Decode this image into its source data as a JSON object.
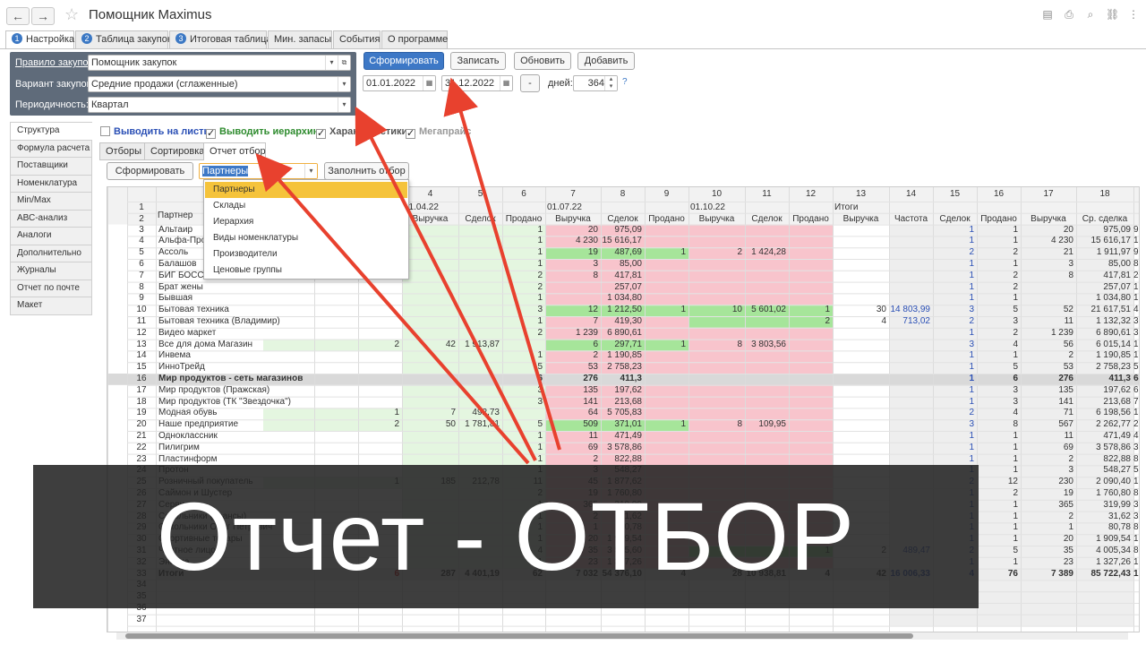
{
  "window": {
    "title": "Помощник Maximus"
  },
  "tabs": [
    {
      "num": "1",
      "label": "Настройка"
    },
    {
      "num": "2",
      "label": "Таблица закупок"
    },
    {
      "num": "3",
      "label": "Итоговая таблица"
    },
    {
      "num": "",
      "label": "Мин. запасы"
    },
    {
      "num": "",
      "label": "События"
    },
    {
      "num": "",
      "label": "О программе"
    }
  ],
  "params": {
    "rule_label": "Правило закупок:",
    "rule_value": "Помощник закупок",
    "variant_label": "Вариант закупок:",
    "variant_value": "Средние продажи (сглаженные)",
    "period_label": "Периодичность:",
    "period_value": "Квартал"
  },
  "toolbar": {
    "form": "Сформировать",
    "write": "Записать",
    "refresh": "Обновить",
    "add": "Добавить",
    "date_from": "01.01.2022",
    "date_to": "31.12.2022",
    "minus": "-",
    "days_label": "дней:",
    "days": "364",
    "help": "?"
  },
  "sidebar": [
    "Структура",
    "Формула расчета",
    "Поставщики",
    "Номенклатура",
    "Min/Max",
    "АВС-анализ",
    "Аналоги",
    "Дополнительно",
    "Журналы",
    "Отчет по почте",
    "Макет"
  ],
  "checkboxes": [
    {
      "label": "Выводить на листы",
      "checked": "",
      "color": "#2a4fb5"
    },
    {
      "label": "Выводить иерархию",
      "checked": "✓",
      "color": "#2e8b2e"
    },
    {
      "label": "Характеристики",
      "checked": "✓",
      "color": "#555"
    },
    {
      "label": "Мегапрайс",
      "checked": "✓",
      "color": "#999"
    }
  ],
  "subtabs": [
    "Отборы",
    "Сортировка",
    "Отчет отбор"
  ],
  "report": {
    "form": "Сформировать",
    "select_value": "Партнеры",
    "fill": "Заполнить отбор"
  },
  "dropdown": [
    "Партнеры",
    "Склады",
    "Иерархия",
    "Виды номенклатуры",
    "Производители",
    "Ценовые группы"
  ],
  "grid": {
    "colnums": [
      "4",
      "5",
      "6",
      "7",
      "8",
      "9",
      "10",
      "11",
      "12",
      "13",
      "14",
      "15",
      "16",
      "17",
      "18"
    ],
    "periods": [
      "01.04.22",
      "01.07.22",
      "01.10.22",
      "Итоги"
    ],
    "partner_hdr": "Партнер",
    "subhdr": [
      "Выручка",
      "Сделок",
      "Продано",
      "Выручка",
      "Сделок",
      "Продано",
      "Выручка",
      "Сделок",
      "Продано",
      "Выручка",
      "Частота",
      "Сделок",
      "Продано",
      "Выручка",
      "Ср. сделка"
    ],
    "rows": [
      [
        "3",
        "Альтаир",
        "",
        "",
        "",
        "1",
        "20",
        "975,09",
        "",
        "",
        "",
        "",
        "",
        "",
        "1",
        "1",
        "20",
        "975,09",
        "975,09"
      ],
      [
        "4",
        "Альфа-Про",
        "",
        "",
        "",
        "1",
        "4 230",
        "15 616,17",
        "",
        "",
        "",
        "",
        "",
        "",
        "1",
        "1",
        "4 230",
        "15 616,17",
        "15 616,17"
      ],
      [
        "5",
        "Ассоль",
        "",
        "",
        "",
        "1",
        "19",
        "487,69",
        "1",
        "2",
        "1 424,28",
        "",
        "",
        "",
        "2",
        "2",
        "21",
        "1 911,97",
        "955,99"
      ],
      [
        "6",
        "Балашов",
        "",
        "",
        "",
        "1",
        "3",
        "85,00",
        "",
        "",
        "",
        "",
        "",
        "",
        "1",
        "1",
        "3",
        "85,00",
        "85,00"
      ],
      [
        "7",
        "БИГ БОСС",
        "",
        "",
        "",
        "2",
        "8",
        "417,81",
        "",
        "",
        "",
        "",
        "",
        "",
        "1",
        "2",
        "8",
        "417,81",
        "208,91"
      ],
      [
        "8",
        "Брат жены",
        "",
        "",
        "",
        "2",
        "",
        "257,07",
        "",
        "",
        "",
        "",
        "",
        "",
        "1",
        "2",
        "",
        "257,07",
        "128,54"
      ],
      [
        "9",
        "Бывшая",
        "",
        "",
        "",
        "1",
        "",
        "1 034,80",
        "",
        "",
        "",
        "",
        "",
        "",
        "1",
        "1",
        "",
        "1 034,80",
        "1 034,80"
      ],
      [
        "10",
        "Бытовая техника",
        "",
        "",
        "",
        "3",
        "12",
        "1 212,50",
        "1",
        "10",
        "5 601,02",
        "1",
        "30",
        "14 803,99",
        "3",
        "5",
        "52",
        "21 617,51",
        "4 323,50"
      ],
      [
        "11",
        "Бытовая техника (Владимир)",
        "",
        "",
        "",
        "1",
        "7",
        "419,30",
        "",
        "",
        "",
        "2",
        "4",
        "713,02",
        "2",
        "3",
        "11",
        "1 132,32",
        "377,44"
      ],
      [
        "12",
        "Видео маркет",
        "",
        "",
        "",
        "2",
        "1 239",
        "6 890,61",
        "",
        "",
        "",
        "",
        "",
        "",
        "1",
        "2",
        "1 239",
        "6 890,61",
        "3 445,31"
      ],
      [
        "13",
        "Все для дома Магазин",
        "2",
        "42",
        "1 913,87",
        "",
        "6",
        "297,71",
        "1",
        "8",
        "3 803,56",
        "",
        "",
        "",
        "3",
        "4",
        "56",
        "6 015,14",
        "1 503,79"
      ],
      [
        "14",
        "Инвема",
        "",
        "",
        "",
        "1",
        "2",
        "1 190,85",
        "",
        "",
        "",
        "",
        "",
        "",
        "1",
        "1",
        "2",
        "1 190,85",
        "1 190,85"
      ],
      [
        "15",
        "ИнноТрейд",
        "",
        "",
        "",
        "5",
        "53",
        "2 758,23",
        "",
        "",
        "",
        "",
        "",
        "",
        "1",
        "5",
        "53",
        "2 758,23",
        "551,65"
      ],
      [
        "16",
        "Мир продуктов - сеть магазинов",
        "",
        "",
        "",
        "6",
        "276",
        "411,3",
        "",
        "",
        "",
        "",
        "",
        "",
        "1",
        "6",
        "276",
        "411,3",
        "68,55"
      ],
      [
        "17",
        "Мир продуктов (Пражская)",
        "",
        "",
        "",
        "3",
        "135",
        "197,62",
        "",
        "",
        "",
        "",
        "",
        "",
        "1",
        "3",
        "135",
        "197,62",
        "65,87"
      ],
      [
        "18",
        "Мир продуктов (ТК \"Звездочка\")",
        "",
        "",
        "",
        "3",
        "141",
        "213,68",
        "",
        "",
        "",
        "",
        "",
        "",
        "1",
        "3",
        "141",
        "213,68",
        "71,23"
      ],
      [
        "19",
        "Модная обувь",
        "1",
        "7",
        "492,73",
        "",
        "64",
        "5 705,83",
        "",
        "",
        "",
        "",
        "",
        "",
        "2",
        "4",
        "71",
        "6 198,56",
        "1 549,64"
      ],
      [
        "20",
        "Наше предприятие",
        "2",
        "50",
        "1 781,81",
        "5",
        "509",
        "371,01",
        "1",
        "8",
        "109,95",
        "",
        "",
        "",
        "3",
        "8",
        "567",
        "2 262,77",
        "282,85"
      ],
      [
        "21",
        "Одноклассник",
        "",
        "",
        "",
        "1",
        "11",
        "471,49",
        "",
        "",
        "",
        "",
        "",
        "",
        "1",
        "1",
        "11",
        "471,49",
        "471,49"
      ],
      [
        "22",
        "Пилигрим",
        "",
        "",
        "",
        "1",
        "69",
        "3 578,86",
        "",
        "",
        "",
        "",
        "",
        "",
        "1",
        "1",
        "69",
        "3 578,86",
        "3 578,86"
      ],
      [
        "23",
        "Пластинформ",
        "",
        "",
        "",
        "1",
        "2",
        "822,88",
        "",
        "",
        "",
        "",
        "",
        "",
        "1",
        "1",
        "2",
        "822,88",
        "822,88"
      ],
      [
        "24",
        "Протон",
        "",
        "",
        "",
        "1",
        "3",
        "548,27",
        "",
        "",
        "",
        "",
        "",
        "",
        "1",
        "1",
        "3",
        "548,27",
        "548,27"
      ],
      [
        "25",
        "Розничный покупатель",
        "1",
        "185",
        "212,78",
        "11",
        "45",
        "1 877,62",
        "",
        "",
        "",
        "",
        "",
        "",
        "2",
        "12",
        "230",
        "2 090,40",
        "174,20"
      ],
      [
        "26",
        "Саймон и Шустер",
        "",
        "",
        "",
        "2",
        "19",
        "1 760,80",
        "",
        "",
        "",
        "",
        "",
        "",
        "1",
        "2",
        "19",
        "1 760,80",
        "880,40"
      ],
      [
        "27",
        "Сервис",
        "",
        "",
        "",
        "1",
        "365",
        "319,99",
        "",
        "",
        "",
        "",
        "",
        "",
        "1",
        "1",
        "365",
        "319,99",
        "319,99"
      ],
      [
        "28",
        "Сокольники (авансы)",
        "",
        "",
        "",
        "1",
        "2",
        "31,62",
        "",
        "",
        "",
        "",
        "",
        "",
        "1",
        "1",
        "2",
        "31,62",
        "31,62"
      ],
      [
        "29",
        "Сокольники Олег Петрович",
        "",
        "",
        "",
        "1",
        "1",
        "80,78",
        "",
        "",
        "",
        "",
        "",
        "",
        "1",
        "1",
        "1",
        "80,78",
        "80,78"
      ],
      [
        "30",
        "Спортивные товары",
        "",
        "",
        "",
        "1",
        "20",
        "1 909,54",
        "",
        "",
        "",
        "",
        "",
        "",
        "1",
        "1",
        "20",
        "1 909,54",
        "1 909,54"
      ],
      [
        "31",
        "Частное лицо",
        "",
        "",
        "",
        "4",
        "35",
        "3 515,60",
        "",
        "",
        "",
        "1",
        "2",
        "489,47",
        "2",
        "5",
        "35",
        "4 005,34",
        "801,07"
      ],
      [
        "32",
        "Энигма",
        "",
        "",
        "",
        "1",
        "23",
        "1 327,26",
        "",
        "",
        "",
        "",
        "",
        "",
        "1",
        "1",
        "23",
        "1 327,26",
        "1 327,26"
      ],
      [
        "33",
        "Итоги",
        "6",
        "287",
        "4 401,19",
        "62",
        "7 032",
        "54 376,10",
        "4",
        "28",
        "10 938,81",
        "4",
        "42",
        "16 006,33",
        "4",
        "76",
        "7 389",
        "85 722,43",
        "1 127,93"
      ],
      [
        "34",
        "",
        "",
        "",
        "",
        "",
        "",
        "",
        "",
        "",
        "",
        "",
        "",
        "",
        "",
        "",
        "",
        "",
        ""
      ],
      [
        "35",
        "",
        "",
        "",
        "",
        "",
        "",
        "",
        "",
        "",
        "",
        "",
        "",
        "",
        "",
        "",
        "",
        "",
        ""
      ],
      [
        "36",
        "",
        "",
        "",
        "",
        "",
        "",
        "",
        "",
        "",
        "",
        "",
        "",
        "",
        "",
        "",
        "",
        "",
        ""
      ],
      [
        "37",
        "",
        "",
        "",
        "",
        "",
        "",
        "",
        "",
        "",
        "",
        "",
        "",
        "",
        "",
        "",
        "",
        "",
        ""
      ]
    ]
  },
  "overlay_text": "Отчет - ОТБОР",
  "colors": {
    "accent": "#3d78c6",
    "pink": "#f8c4cc",
    "green": "#a6e59a",
    "lightgreen": "#e4f6e0",
    "highlight": "#f5c33b",
    "arrow": "#e8412e"
  }
}
